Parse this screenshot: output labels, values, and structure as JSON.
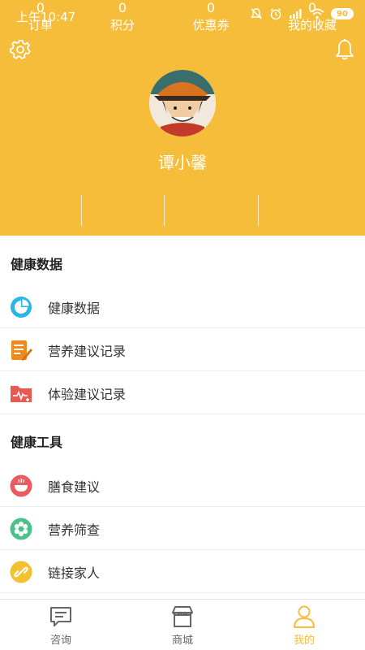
{
  "status_bar": {
    "time": "上午10:47",
    "battery": "90"
  },
  "profile": {
    "username": "谭小馨"
  },
  "stats": [
    {
      "count": "0",
      "label": "订单"
    },
    {
      "count": "0",
      "label": "积分"
    },
    {
      "count": "0",
      "label": "优惠券"
    },
    {
      "count": "0",
      "label": "我的收藏"
    }
  ],
  "health_data": {
    "title": "健康数据",
    "items": [
      {
        "label": "健康数据",
        "icon": "pie-chart-icon"
      },
      {
        "label": "营养建议记录",
        "icon": "notepad-icon"
      },
      {
        "label": "体验建议记录",
        "icon": "folder-heartbeat-icon"
      }
    ]
  },
  "health_tools": {
    "title": "健康工具",
    "items": [
      {
        "label": "膳食建议",
        "icon": "bowl-icon"
      },
      {
        "label": "营养筛查",
        "icon": "flower-icon"
      },
      {
        "label": "链接家人",
        "icon": "link-icon"
      }
    ]
  },
  "tabs": [
    {
      "label": "咨询",
      "icon": "chat-icon",
      "active": false
    },
    {
      "label": "商城",
      "icon": "shop-icon",
      "active": false
    },
    {
      "label": "我的",
      "icon": "person-icon",
      "active": true
    }
  ],
  "colors": {
    "brand": "#F5BD39",
    "tab_active": "#F5BD39",
    "tab_inactive": "#666666"
  }
}
